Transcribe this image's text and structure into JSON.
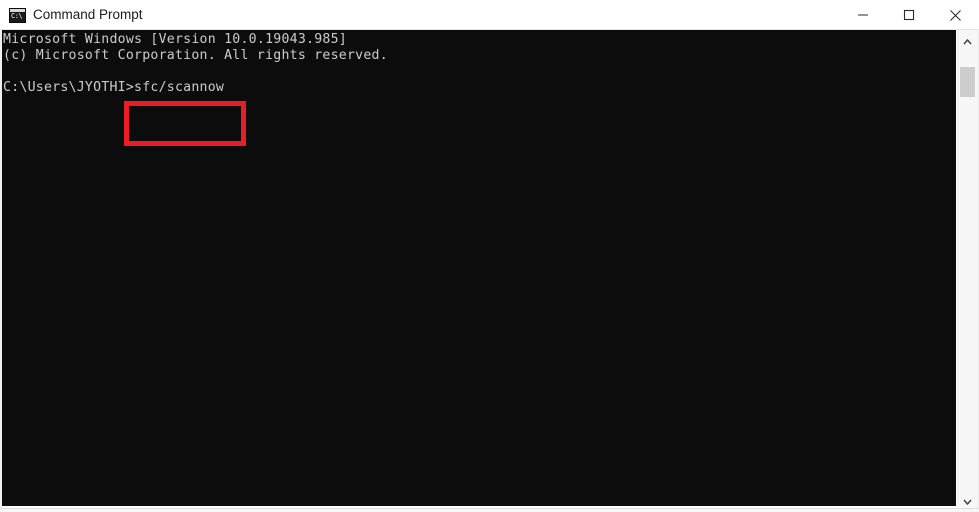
{
  "window": {
    "title": "Command Prompt",
    "icon": "console-icon",
    "icon_glyph": "C:\\",
    "background_color": "#0c0c0c",
    "text_color": "#cccccc"
  },
  "titlebar": {
    "minimize_label": "Minimize",
    "maximize_label": "Maximize",
    "close_label": "Close"
  },
  "console": {
    "lines": [
      "Microsoft Windows [Version 10.0.19043.985]",
      "(c) Microsoft Corporation. All rights reserved.",
      "",
      "C:\\Users\\JYOTHI>sfc/scannow"
    ],
    "content": "Microsoft Windows [Version 10.0.19043.985]\n(c) Microsoft Corporation. All rights reserved.\n\nC:\\Users\\JYOTHI>sfc/scannow",
    "os_name": "Microsoft Windows",
    "os_version": "10.0.19043.985",
    "copyright": "(c) Microsoft Corporation. All rights reserved.",
    "prompt_path": "C:\\Users\\JYOTHI>",
    "command": "sfc/scannow"
  },
  "annotation": {
    "type": "highlight-rectangle",
    "color": "#ea1d26",
    "target_text": "sfc/scannow"
  },
  "scrollbar": {
    "up_arrow": "chevron-up-icon",
    "down_arrow": "chevron-down-icon",
    "thumb_color": "#cdcdcd"
  }
}
